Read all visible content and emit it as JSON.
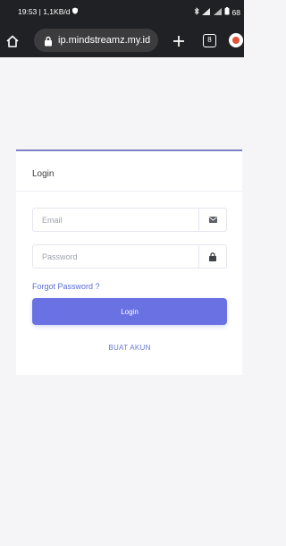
{
  "status_bar": {
    "time_info": "19:53 | 1,1KB/d",
    "battery": "68"
  },
  "browser": {
    "url": "ip.mindstreamz.my.id",
    "tab_count": "8"
  },
  "login_card": {
    "title": "Login",
    "email_placeholder": "Email",
    "password_placeholder": "Password",
    "forgot_password": "Forgot Password ?",
    "login_button": "Login",
    "register_link": "BUAT AKUN"
  },
  "colors": {
    "accent": "#6a72e3",
    "link": "#5a6bd6",
    "card_border_top": "#7d82c8",
    "browser_bg": "#202124"
  },
  "icons": {
    "email_addon": "envelope-icon",
    "password_addon": "lock-icon",
    "url_secure": "lock-icon"
  }
}
